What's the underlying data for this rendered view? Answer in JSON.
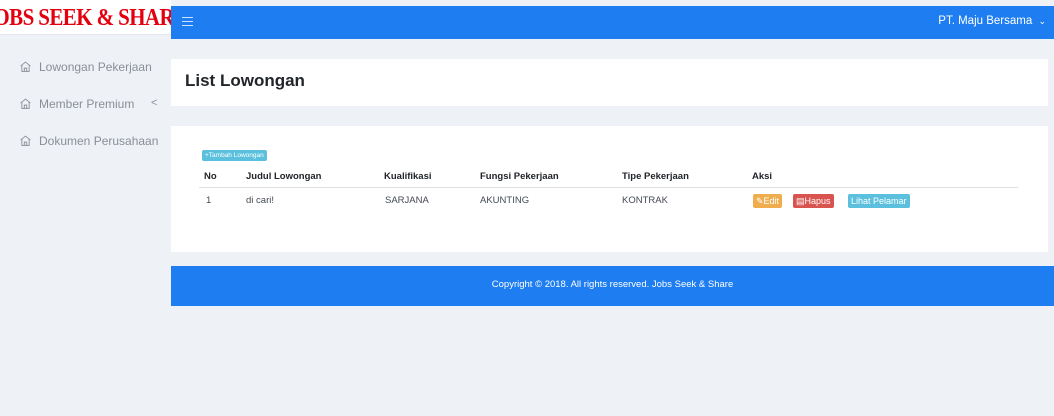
{
  "brand": {
    "logo_text": "Jobs Seek & Share"
  },
  "sidebar": {
    "items": [
      {
        "label": "Lowongan Pekerjaan",
        "icon": "home-icon",
        "has_chevron": false
      },
      {
        "label": "Member Premium",
        "icon": "home-icon",
        "has_chevron": true,
        "chevron": "<"
      },
      {
        "label": "Dokumen Perusahaan",
        "icon": "home-icon",
        "has_chevron": false
      }
    ]
  },
  "topbar": {
    "menu_icon": "hamburger-icon",
    "user_name": "PT. Maju Bersama",
    "user_caret_icon": "chevron-down-icon",
    "color": "#1e7df1"
  },
  "page": {
    "title": "List Lowongan"
  },
  "table": {
    "add_button_label": "+Tambah Lowongan",
    "columns": [
      "No",
      "Judul Lowongan",
      "Kualifikasi",
      "Fungsi Pekerjaan",
      "Tipe Pekerjaan",
      "Aksi"
    ],
    "rows": [
      {
        "no": "1",
        "judul": "di cari!",
        "kualifikasi": "SARJANA",
        "fungsi": "AKUNTING",
        "tipe": "KONTRAK",
        "actions": {
          "edit": "Edit",
          "hapus": "Hapus",
          "lihat": "Lihat Pelamar"
        }
      }
    ]
  },
  "footer": {
    "text": "Copyright © 2018. All rights reserved. Jobs Seek & Share"
  },
  "colors": {
    "accent": "#1e7df1",
    "logo": "#e3000f",
    "edit": "#f0ad4e",
    "delete": "#d9534f",
    "info": "#5bc0de"
  }
}
